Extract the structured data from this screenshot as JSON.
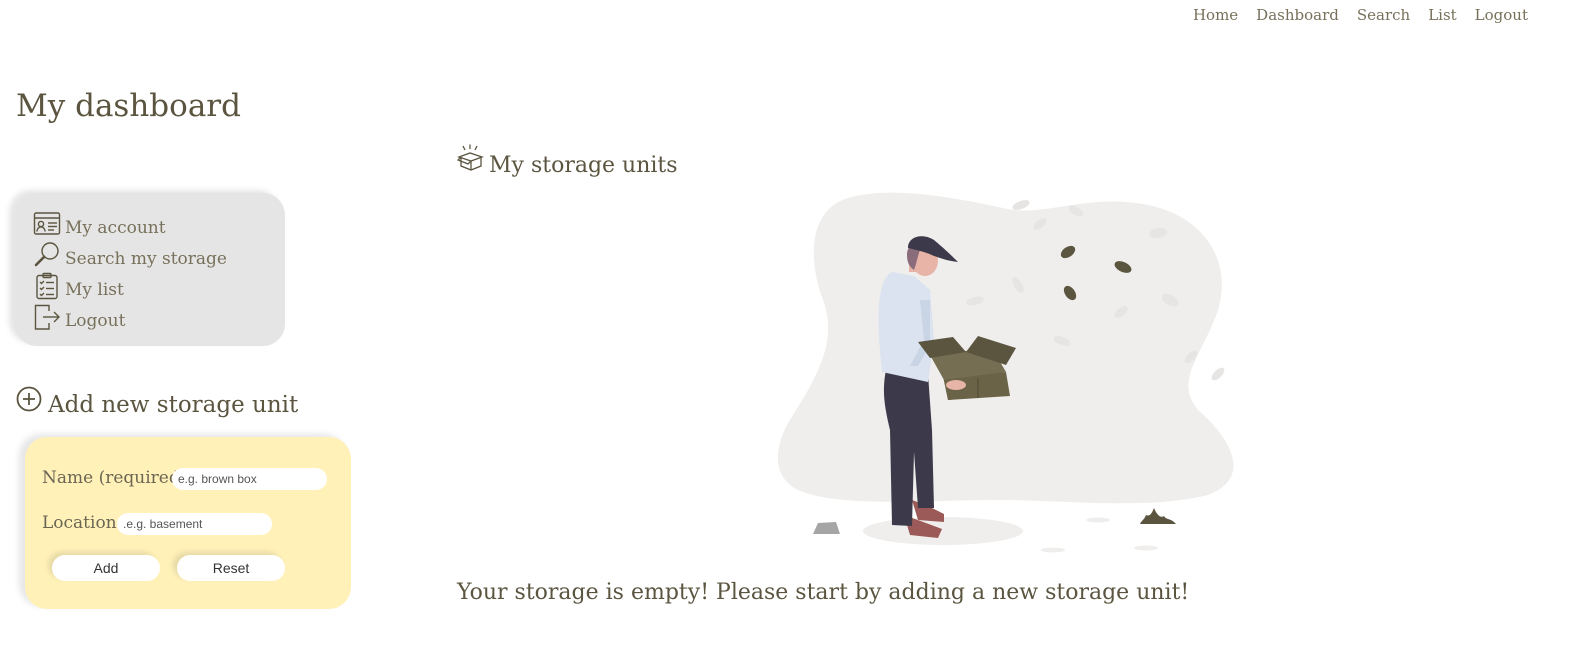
{
  "nav": {
    "items": [
      {
        "label": "Home"
      },
      {
        "label": "Dashboard"
      },
      {
        "label": "Search"
      },
      {
        "label": "List"
      },
      {
        "label": "Logout"
      }
    ]
  },
  "page": {
    "title": "My dashboard"
  },
  "sidebar": {
    "items": [
      {
        "label": "My account",
        "icon": "id-card-icon"
      },
      {
        "label": "Search my storage",
        "icon": "magnifier-icon"
      },
      {
        "label": "My list",
        "icon": "clipboard-checklist-icon"
      },
      {
        "label": "Logout",
        "icon": "exit-door-icon"
      }
    ]
  },
  "add_unit": {
    "heading": "Add new storage unit",
    "icon": "plus-circle-icon",
    "name_label": "Name (required):",
    "name_placeholder": "e.g. brown box",
    "location_label": "Location:",
    "location_placeholder": ".e.g. basement",
    "add_label": "Add",
    "reset_label": "Reset"
  },
  "storage": {
    "heading": "My storage units",
    "icon": "open-box-icon",
    "empty_message": "Your storage is empty! Please start by adding a new storage unit!"
  },
  "colors": {
    "text": "#5b5540",
    "menu_bg": "#e5e5e5",
    "form_bg": "#fff1b8",
    "accent": "#6b6348"
  }
}
